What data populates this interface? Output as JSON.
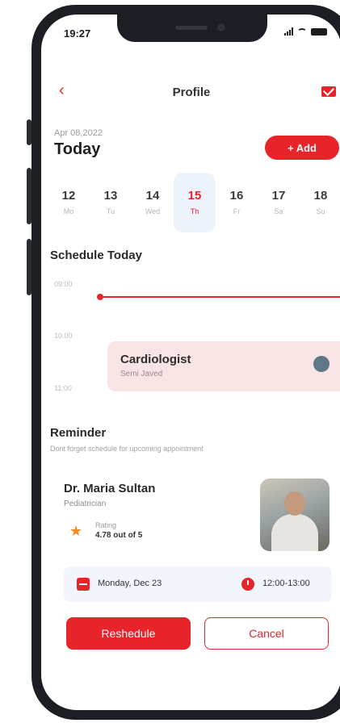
{
  "status_bar": {
    "time": "19:27"
  },
  "header": {
    "back_icon": "chevron-left-icon",
    "title": "Profile",
    "mail_icon": "mail-icon"
  },
  "date_header": {
    "date": "Apr 08,2022",
    "label": "Today",
    "add_label": "+ Add"
  },
  "days": [
    {
      "num": "12",
      "name": "Mo"
    },
    {
      "num": "13",
      "name": "Tu"
    },
    {
      "num": "14",
      "name": "Wed"
    },
    {
      "num": "15",
      "name": "Th",
      "active": true
    },
    {
      "num": "16",
      "name": "Fr"
    },
    {
      "num": "17",
      "name": "Sa"
    },
    {
      "num": "18",
      "name": "Su"
    }
  ],
  "schedule": {
    "title": "Schedule Today",
    "times": [
      "09:00",
      "10:00",
      "11:00"
    ],
    "appointment": {
      "title": "Cardiologist",
      "subtitle": "Semi Javed"
    }
  },
  "reminder": {
    "title": "Reminder",
    "subtitle": "Dont forget schedule for upcoming appointment",
    "doctor": {
      "name": "Dr. Maria Sultan",
      "specialty": "Pediatrician",
      "rating_label": "Rating",
      "rating_value": "4.78 out of 5"
    },
    "date": "Monday, Dec 23",
    "time": "12:00-13:00"
  },
  "actions": {
    "primary": "Reshedule",
    "secondary": "Cancel"
  },
  "colors": {
    "accent": "#e8242b",
    "active_day_bg": "#eef2fb",
    "card_bg": "#f8e4e4"
  }
}
